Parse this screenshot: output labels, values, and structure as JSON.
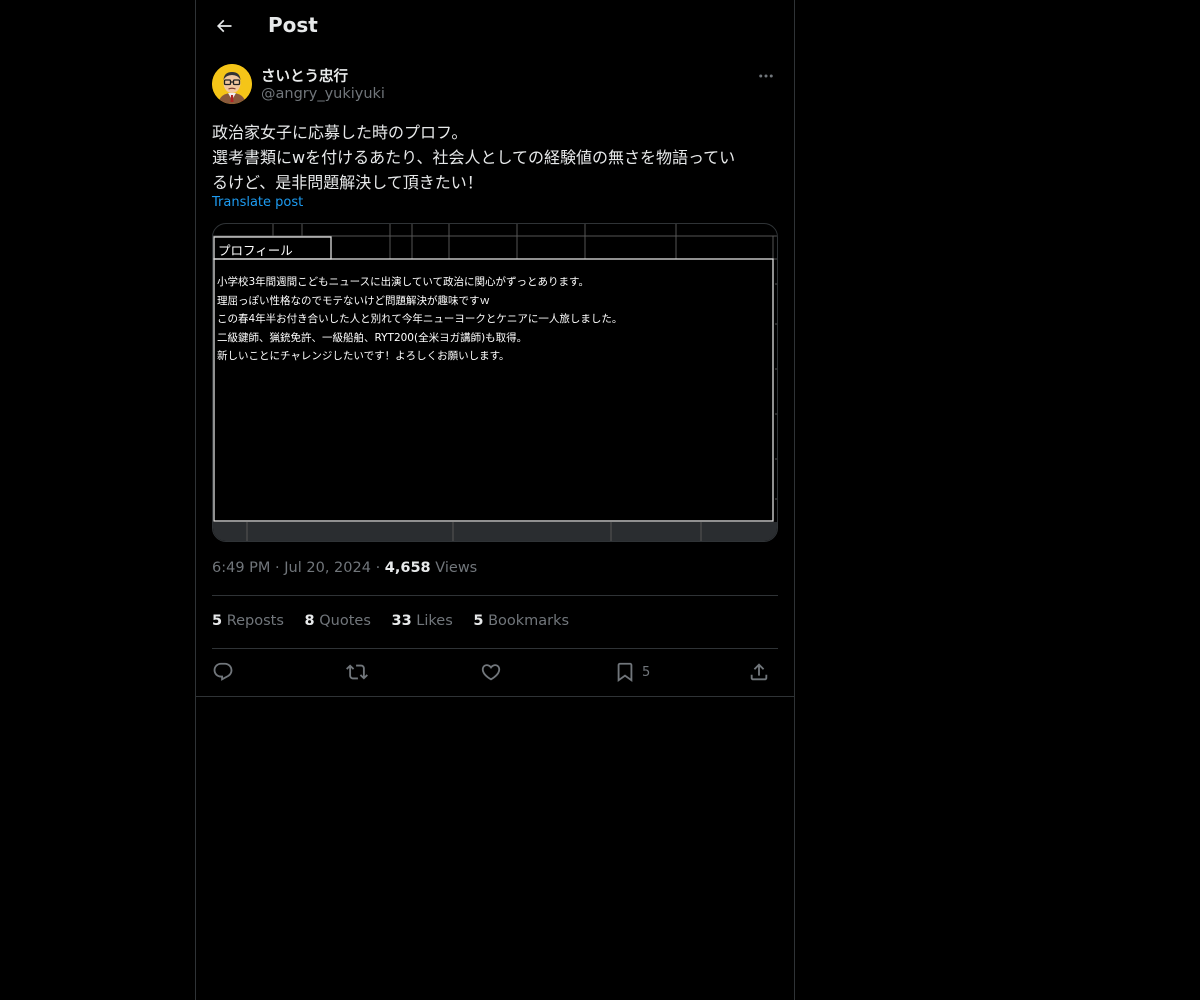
{
  "header": {
    "title": "Post"
  },
  "author": {
    "display_name": "さいとう忠行",
    "handle": "@angry_yukiyuki"
  },
  "post": {
    "lines": [
      "政治家女子に応募した時のプロフ。",
      "選考書類にwを付けるあたり、社会人としての経験値の無さを物語ってい",
      "るけど、是非問題解決して頂きたい！"
    ],
    "translate_label": "Translate post"
  },
  "media": {
    "label": "プロフィール",
    "lines": [
      "小学校3年間週間こどもニュースに出演していて政治に関心がずっとあります。",
      "理屈っぽい性格なのでモテないけど問題解決が趣味ですｗ",
      "この春4年半お付き合いした人と別れて今年ニューヨークとケニアに一人旅しました。",
      "二級鍵師、猟銃免許、一級船舶、RYT200(全米ヨガ講師)も取得。",
      "新しいことにチャレンジしたいです！よろしくお願いします。"
    ]
  },
  "meta": {
    "time": "6:49 PM",
    "date": "Jul 20, 2024",
    "views_count": "4,658",
    "views_label": "Views",
    "sep": "·"
  },
  "stats": {
    "reposts": {
      "count": "5",
      "label": "Reposts"
    },
    "quotes": {
      "count": "8",
      "label": "Quotes"
    },
    "likes": {
      "count": "33",
      "label": "Likes"
    },
    "bookmarks": {
      "count": "5",
      "label": "Bookmarks"
    }
  },
  "actions": {
    "bookmark_count": "5"
  },
  "icons": [
    "back-arrow-icon",
    "more-icon",
    "reply-icon",
    "repost-icon",
    "like-icon",
    "bookmark-icon",
    "share-icon"
  ],
  "colors": {
    "background": "#000000",
    "text": "#e7e9ea",
    "muted": "#71767b",
    "link": "#1d9bf0",
    "border": "#2f3336"
  }
}
